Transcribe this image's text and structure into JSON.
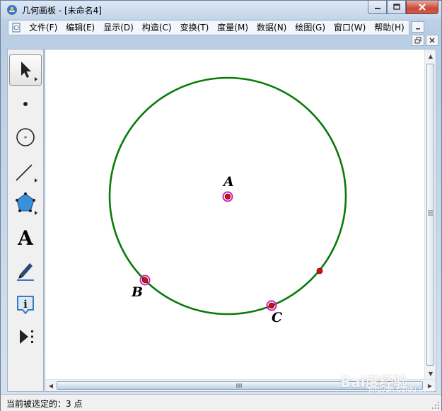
{
  "window": {
    "title": "几何画板 - [未命名4]"
  },
  "menubar": {
    "items": [
      {
        "label": "文件(F)"
      },
      {
        "label": "编辑(E)"
      },
      {
        "label": "显示(D)"
      },
      {
        "label": "构造(C)"
      },
      {
        "label": "变换(T)"
      },
      {
        "label": "度量(M)"
      },
      {
        "label": "数据(N)"
      },
      {
        "label": "绘图(G)"
      },
      {
        "label": "窗口(W)"
      },
      {
        "label": "帮助(H)"
      }
    ]
  },
  "toolbox": {
    "tools": [
      {
        "name": "arrow-select-tool",
        "icon": "arrow-icon",
        "selected": true
      },
      {
        "name": "point-tool",
        "icon": "point-icon"
      },
      {
        "name": "compass-tool",
        "icon": "circle-icon"
      },
      {
        "name": "straightedge-tool",
        "icon": "segment-icon"
      },
      {
        "name": "polygon-tool",
        "icon": "pentagon-icon"
      },
      {
        "name": "text-tool",
        "icon": "text-icon",
        "glyph": "A"
      },
      {
        "name": "marker-tool",
        "icon": "marker-pen-icon"
      },
      {
        "name": "information-tool",
        "icon": "info-icon",
        "glyph": "i"
      },
      {
        "name": "custom-tool",
        "icon": "play-more-icon"
      }
    ]
  },
  "sketch": {
    "circle_color": "#0a7a0a",
    "selected_point_ring": "#d020c0",
    "point_fill": "#d01010",
    "points": [
      {
        "label": "A",
        "selected": true
      },
      {
        "label": "B",
        "selected": true
      },
      {
        "label": "C",
        "selected": true
      },
      {
        "label": "",
        "selected": false
      }
    ]
  },
  "statusbar": {
    "text": "当前被选定的：3 点"
  },
  "watermark": {
    "text": "Bai度经验",
    "sub": "jingyan.baidu.com"
  }
}
